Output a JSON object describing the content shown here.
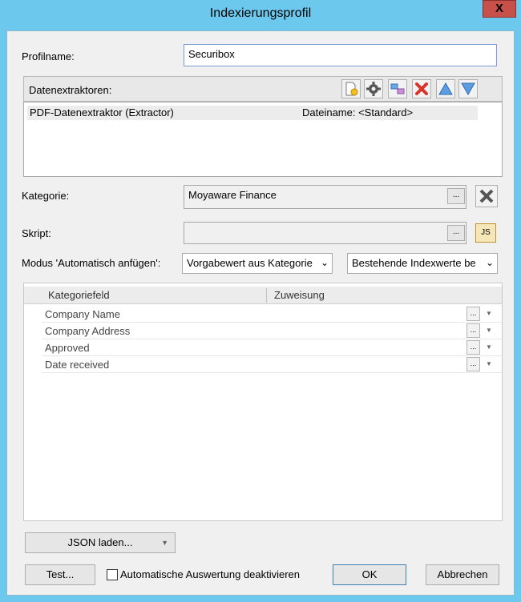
{
  "window": {
    "title": "Indexierungsprofil",
    "close_glyph": "X"
  },
  "profile": {
    "label": "Profilname:",
    "value": "Securibox"
  },
  "extractors": {
    "label": "Datenextraktoren:",
    "toolbar_icons": [
      "new-extractor-icon",
      "gear-icon",
      "link-icon",
      "delete-icon",
      "move-up-icon",
      "move-down-icon"
    ],
    "rows": [
      {
        "name": "PDF-Datenextraktor (Extractor)",
        "file": "Dateiname: <Standard>"
      }
    ]
  },
  "category": {
    "label": "Kategorie:",
    "value": "Moyaware Finance",
    "browse_label": "..."
  },
  "script": {
    "label": "Skript:",
    "value": "",
    "browse_label": "...",
    "js_label": "JS"
  },
  "mode": {
    "label": "Modus 'Automatisch anfügen':",
    "default_value": "Vorgabewert aus Kategorie",
    "existing_value": "Bestehende Indexwerte be"
  },
  "grid": {
    "headers": [
      "Kategoriefeld",
      "Zuweisung"
    ],
    "rows": [
      {
        "field": "Company Name",
        "assignment": ""
      },
      {
        "field": "Company Address",
        "assignment": ""
      },
      {
        "field": "Approved",
        "assignment": ""
      },
      {
        "field": "Date received",
        "assignment": ""
      }
    ],
    "browse_label": "...",
    "dropdown_glyph": "▼"
  },
  "buttons": {
    "json_load": "JSON laden...",
    "test": "Test...",
    "auto_eval_label": "Automatische Auswertung deaktivieren",
    "ok": "OK",
    "cancel": "Abbrechen"
  }
}
